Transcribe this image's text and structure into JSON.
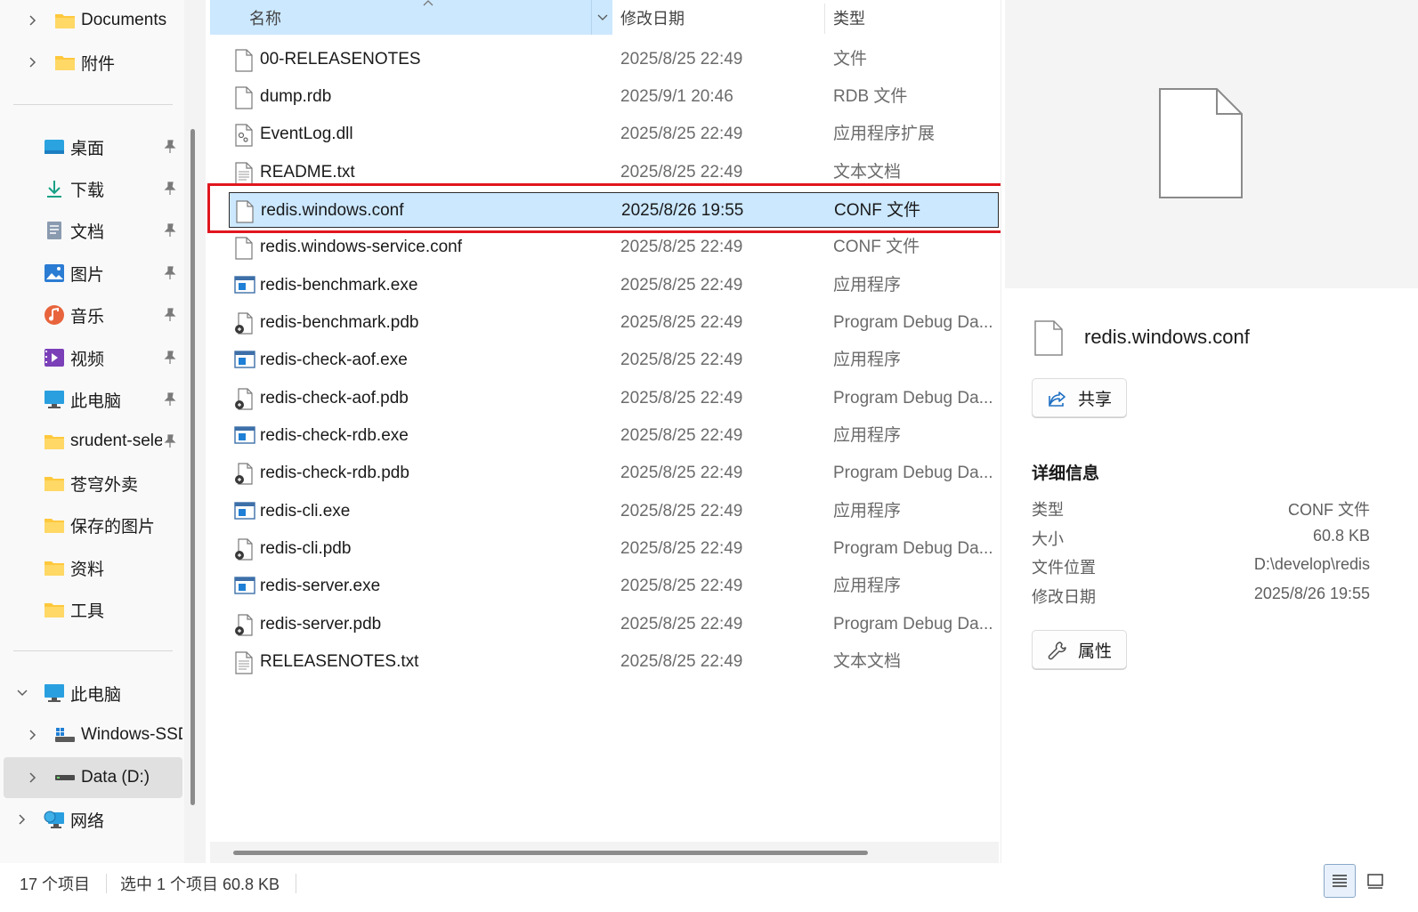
{
  "sidebar": {
    "items": [
      {
        "label": "Documents",
        "icon": "folder-icon"
      },
      {
        "label": "附件",
        "icon": "folder-icon"
      },
      {
        "label": "桌面",
        "icon": "desktop-icon",
        "pinned": true
      },
      {
        "label": "下载",
        "icon": "download-icon",
        "pinned": true
      },
      {
        "label": "文档",
        "icon": "document-icon",
        "pinned": true
      },
      {
        "label": "图片",
        "icon": "pictures-icon",
        "pinned": true
      },
      {
        "label": "音乐",
        "icon": "music-icon",
        "pinned": true
      },
      {
        "label": "视频",
        "icon": "videos-icon",
        "pinned": true
      },
      {
        "label": "此电脑",
        "icon": "computer-icon",
        "pinned": true
      },
      {
        "label": "srudent-sele",
        "icon": "folder-icon",
        "pinned": true
      },
      {
        "label": "苍穹外卖",
        "icon": "folder-icon"
      },
      {
        "label": "保存的图片",
        "icon": "folder-icon"
      },
      {
        "label": "资料",
        "icon": "folder-icon"
      },
      {
        "label": "工具",
        "icon": "folder-icon"
      }
    ],
    "this_pc": {
      "label": "此电脑",
      "icon": "computer-icon"
    },
    "drives": [
      {
        "label": "Windows-SSD",
        "icon": "windows-drive-icon"
      },
      {
        "label": "Data (D:)",
        "icon": "drive-icon",
        "selected": true
      }
    ],
    "network": {
      "label": "网络",
      "icon": "network-icon"
    }
  },
  "columns": {
    "name": "名称",
    "date": "修改日期",
    "type": "类型"
  },
  "files": [
    {
      "name": "00-RELEASENOTES",
      "date": "2025/8/25 22:49",
      "type": "文件",
      "icon": "file-icon"
    },
    {
      "name": "dump.rdb",
      "date": "2025/9/1 20:46",
      "type": "RDB 文件",
      "icon": "file-icon"
    },
    {
      "name": "EventLog.dll",
      "date": "2025/8/25 22:49",
      "type": "应用程序扩展",
      "icon": "dll-icon"
    },
    {
      "name": "README.txt",
      "date": "2025/8/25 22:49",
      "type": "文本文档",
      "icon": "text-file-icon"
    },
    {
      "name": "redis.windows.conf",
      "date": "2025/8/26 19:55",
      "type": "CONF 文件",
      "icon": "file-icon",
      "selected": true
    },
    {
      "name": "redis.windows-service.conf",
      "date": "2025/8/25 22:49",
      "type": "CONF 文件",
      "icon": "file-icon"
    },
    {
      "name": "redis-benchmark.exe",
      "date": "2025/8/25 22:49",
      "type": "应用程序",
      "icon": "exe-icon"
    },
    {
      "name": "redis-benchmark.pdb",
      "date": "2025/8/25 22:49",
      "type": "Program Debug Da...",
      "icon": "pdb-icon"
    },
    {
      "name": "redis-check-aof.exe",
      "date": "2025/8/25 22:49",
      "type": "应用程序",
      "icon": "exe-icon"
    },
    {
      "name": "redis-check-aof.pdb",
      "date": "2025/8/25 22:49",
      "type": "Program Debug Da...",
      "icon": "pdb-icon"
    },
    {
      "name": "redis-check-rdb.exe",
      "date": "2025/8/25 22:49",
      "type": "应用程序",
      "icon": "exe-icon"
    },
    {
      "name": "redis-check-rdb.pdb",
      "date": "2025/8/25 22:49",
      "type": "Program Debug Da...",
      "icon": "pdb-icon"
    },
    {
      "name": "redis-cli.exe",
      "date": "2025/8/25 22:49",
      "type": "应用程序",
      "icon": "exe-icon"
    },
    {
      "name": "redis-cli.pdb",
      "date": "2025/8/25 22:49",
      "type": "Program Debug Da...",
      "icon": "pdb-icon"
    },
    {
      "name": "redis-server.exe",
      "date": "2025/8/25 22:49",
      "type": "应用程序",
      "icon": "exe-icon"
    },
    {
      "name": "redis-server.pdb",
      "date": "2025/8/25 22:49",
      "type": "Program Debug Da...",
      "icon": "pdb-icon"
    },
    {
      "name": "RELEASENOTES.txt",
      "date": "2025/8/25 22:49",
      "type": "文本文档",
      "icon": "text-file-icon"
    }
  ],
  "details": {
    "file_name": "redis.windows.conf",
    "share_label": "共享",
    "section_title": "详细信息",
    "properties": [
      {
        "key": "类型",
        "value": "CONF 文件"
      },
      {
        "key": "大小",
        "value": "60.8 KB"
      },
      {
        "key": "文件位置",
        "value": "D:\\develop\\redis"
      },
      {
        "key": "修改日期",
        "value": "2025/8/26 19:55"
      }
    ],
    "properties_label": "属性"
  },
  "status": {
    "count": "17 个项目",
    "selected": "选中 1 个项目  60.8 KB"
  },
  "colors": {
    "selection": "#cce8ff",
    "highlight_box": "#e0161e",
    "folder": "#ffc83d"
  }
}
